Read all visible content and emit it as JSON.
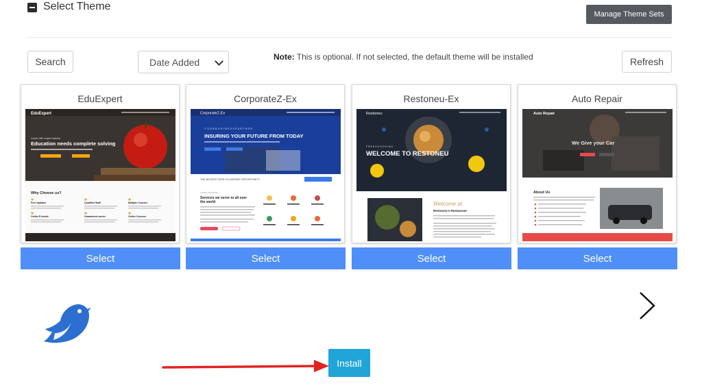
{
  "header": {
    "title": "Select Theme",
    "manage_label": "Manage Theme Sets"
  },
  "toolbar": {
    "search_label": "Search",
    "sort_value": "Date Added",
    "note_bold": "Note:",
    "note_text": "This is optional. If not selected, the default theme will be installed",
    "refresh_label": "Refresh"
  },
  "themes": [
    {
      "name": "EduExpert",
      "select_label": "Select",
      "preview": {
        "brand": "EduExpert",
        "hero_text": "Education needs complete solving",
        "section": "Why Choose us?",
        "features": [
          "Free Updates",
          "Qualified Staff",
          "Multiple Courses",
          "Online E-books",
          "Guaranteed career",
          "Online Courses"
        ]
      }
    },
    {
      "name": "CorporateZ-Ex",
      "select_label": "Select",
      "preview": {
        "brand": "CorporateZ-Ex",
        "hero_text": "INSURING YOUR FUTURE FROM TODAY",
        "strip_text": "THE BIGGEST RISK IS A MISSED OPPORTUNITY.",
        "section": "Services we serve to all over the world"
      }
    },
    {
      "name": "Restoneu-Ex",
      "select_label": "Select",
      "preview": {
        "brand": "Restoneu",
        "hero_text": "WELCOME TO RESTONEU",
        "script": "Welcome at",
        "section": "Restoneu's Restaurant"
      }
    },
    {
      "name": "Auto Repair",
      "select_label": "Select",
      "preview": {
        "brand": "Auto Repair",
        "hero_text": "We Give your Car",
        "section": "About Us"
      }
    }
  ],
  "install_label": "Install",
  "colors": {
    "select": "#4f8ff7",
    "install": "#21a5d6",
    "manage": "#555a60",
    "arrow": "#e32322",
    "logo": "#2d6fd1"
  }
}
